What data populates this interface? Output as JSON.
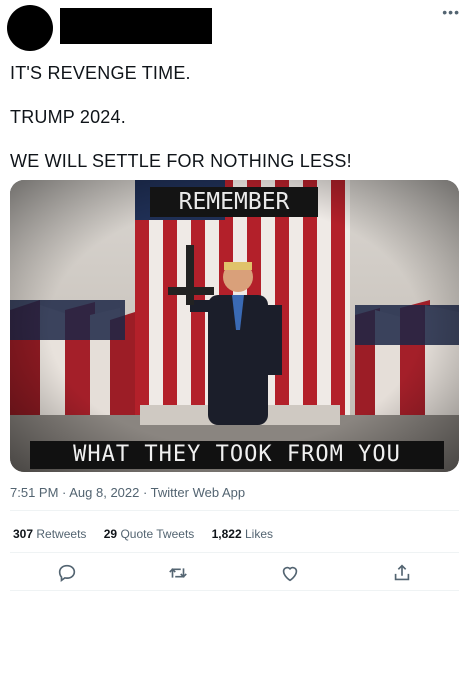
{
  "tweet": {
    "more_icon": "more-horizontal-icon",
    "lines": [
      "IT'S REVENGE TIME.",
      "TRUMP 2024.",
      "WE WILL SETTLE FOR NOTHING LESS!"
    ],
    "image": {
      "top_text": "REMEMBER",
      "bottom_text": "WHAT THEY TOOK FROM YOU"
    },
    "meta": "7:51 PM · Aug 8, 2022 · Twitter Web App",
    "stats": {
      "retweets_count": "307",
      "retweets_label": "Retweets",
      "quotes_count": "29",
      "quotes_label": "Quote Tweets",
      "likes_count": "1,822",
      "likes_label": "Likes"
    },
    "actions": [
      "reply-icon",
      "retweet-icon",
      "like-icon",
      "share-icon"
    ]
  },
  "colors": {
    "meta_text": "#536471",
    "text": "#0f1419",
    "divider": "#eff3f4"
  }
}
